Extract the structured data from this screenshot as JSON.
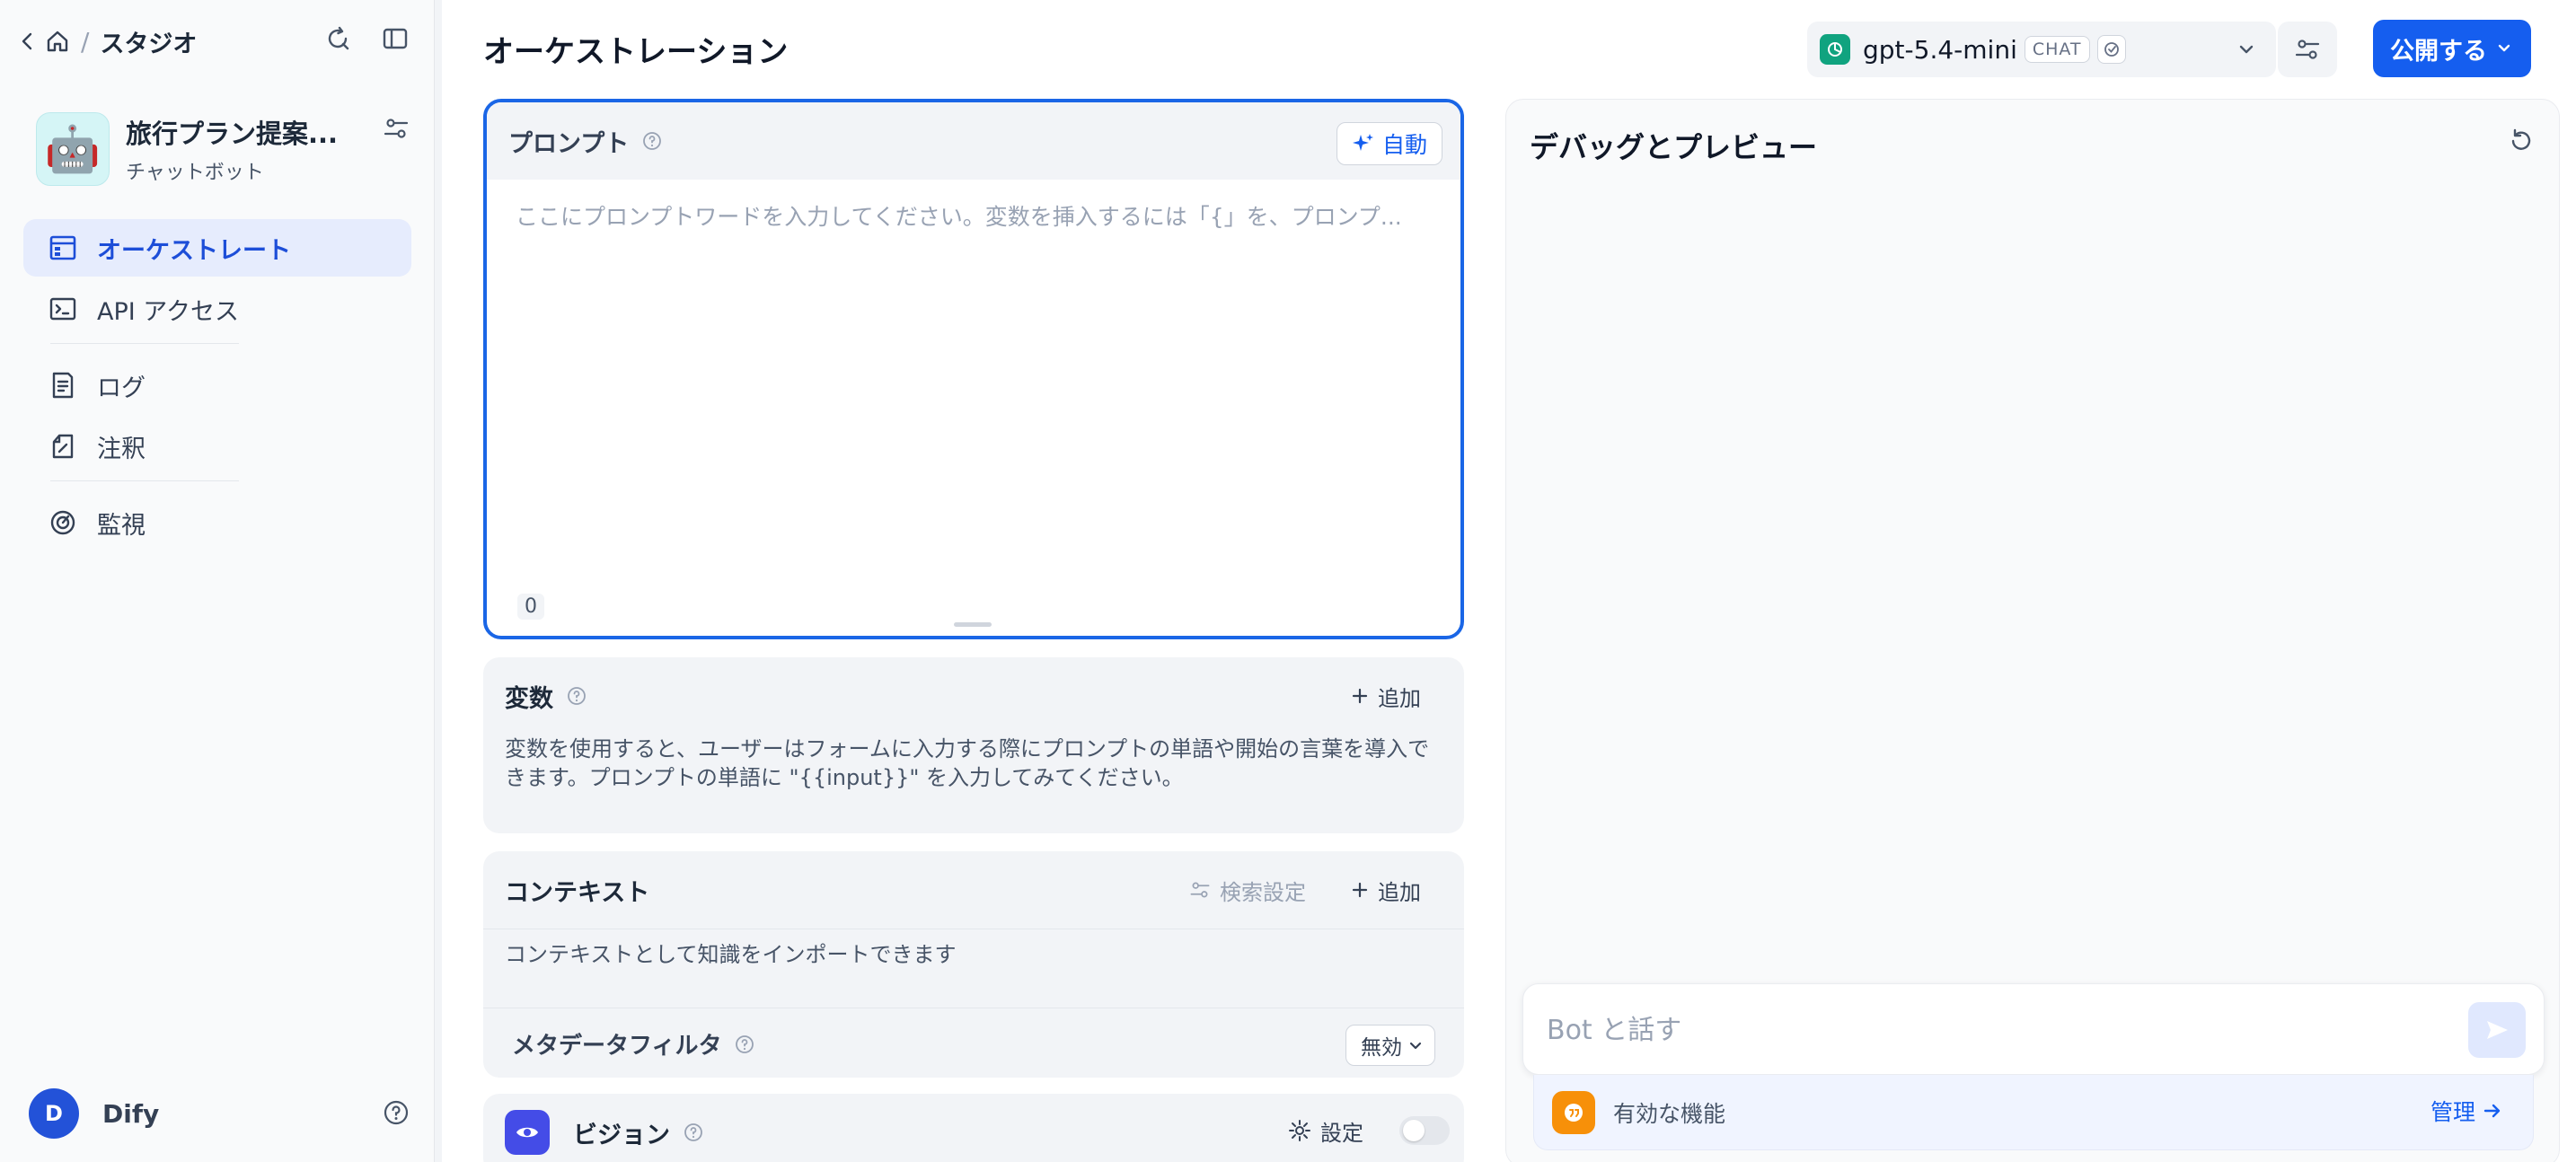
{
  "sidebar": {
    "breadcrumb_title": "スタジオ",
    "app": {
      "name": "旅行プラン提案...",
      "type": "チャットボット"
    },
    "nav": [
      {
        "label": "オーケストレート"
      },
      {
        "label": "API アクセス"
      },
      {
        "label": "ログ"
      },
      {
        "label": "注釈"
      },
      {
        "label": "監視"
      }
    ],
    "user": {
      "initial": "D",
      "name": "Dify"
    }
  },
  "header": {
    "title": "オーケストレーション",
    "model": {
      "name": "gpt-5.4-mini",
      "mode_badge": "CHAT"
    },
    "publish_label": "公開する"
  },
  "prompt": {
    "label": "プロンプト",
    "auto_label": "自動",
    "placeholder": "ここにプロンプトワードを入力してください。変数を挿入するには「{」を、プロンプ...",
    "char_count": "0"
  },
  "variables": {
    "title": "変数",
    "add_label": "追加",
    "description": "変数を使用すると、ユーザーはフォームに入力する際にプロンプトの単語や開始の言葉を導入できます。プロンプトの単語に \"{{input}}\" を入力してみてください。"
  },
  "context": {
    "title": "コンテキスト",
    "search_settings_label": "検索設定",
    "add_label": "追加",
    "description": "コンテキストとして知識をインポートできます",
    "metadata_filter_label": "メタデータフィルタ",
    "metadata_filter_value": "無効"
  },
  "vision": {
    "title": "ビジョン",
    "settings_label": "設定",
    "enabled": false
  },
  "debug": {
    "title": "デバッグとプレビュー",
    "input_placeholder": "Bot と話す",
    "features_label": "有効な機能",
    "manage_label": "管理"
  },
  "colors": {
    "accent": "#155eef",
    "active_nav_bg": "#e6ecfd",
    "prompt_border": "#1a66e6",
    "feature_icon": "#f79009",
    "vision_icon": "#444ce7"
  }
}
